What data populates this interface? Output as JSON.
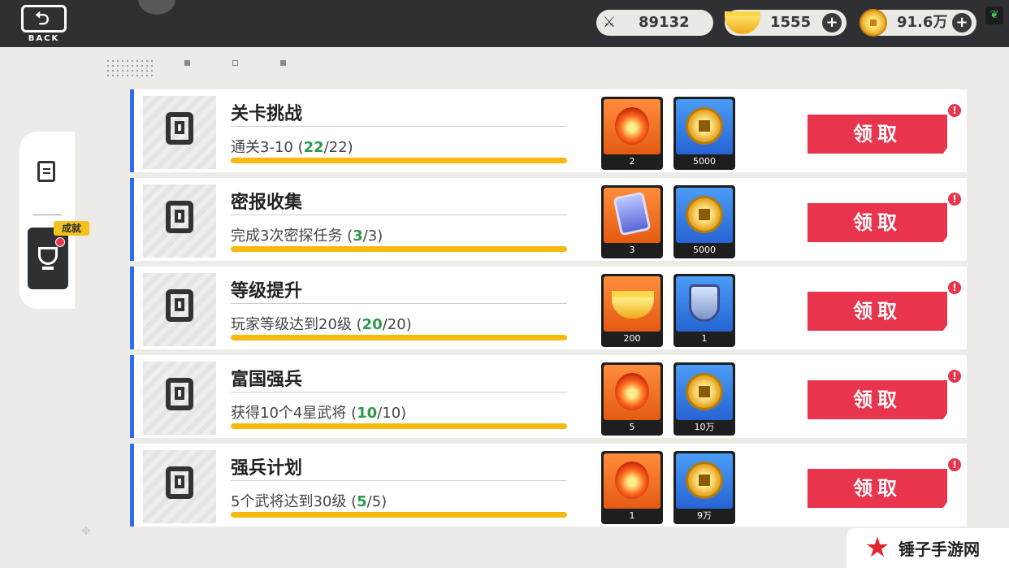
{
  "header": {
    "back_label": "BACK",
    "resources": [
      {
        "icon": "crossed-swords-icon",
        "value": "89132"
      },
      {
        "icon": "gold-ingot-icon",
        "value": "1555"
      },
      {
        "icon": "copper-coin-icon",
        "value": "91.6万"
      }
    ],
    "plus_symbol": "+"
  },
  "sidebar": {
    "active_tab_label": "成就"
  },
  "tasks": [
    {
      "title": "关卡挑战",
      "desc_prefix": "通关3-10 (",
      "current": "22",
      "total": "/22)",
      "progress": 1.0,
      "rewards": [
        {
          "icon": "fire-orb-icon",
          "qty": "2"
        },
        {
          "icon": "copper-coin-icon",
          "qty": "5000"
        }
      ],
      "claim_label": "领取"
    },
    {
      "title": "密报收集",
      "desc_prefix": "完成3次密探任务 (",
      "current": "3",
      "total": "/3)",
      "progress": 1.0,
      "rewards": [
        {
          "icon": "secret-token-icon",
          "qty": "3"
        },
        {
          "icon": "copper-coin-icon",
          "qty": "5000"
        }
      ],
      "claim_label": "领取"
    },
    {
      "title": "等级提升",
      "desc_prefix": "玩家等级达到20级 (",
      "current": "20",
      "total": "/20)",
      "progress": 1.0,
      "rewards": [
        {
          "icon": "gold-ingot-icon",
          "qty": "200"
        },
        {
          "icon": "shield-token-icon",
          "qty": "1"
        }
      ],
      "claim_label": "领取"
    },
    {
      "title": "富国强兵",
      "desc_prefix": "获得10个4星武将 (",
      "current": "10",
      "total": "/10)",
      "progress": 1.0,
      "rewards": [
        {
          "icon": "fire-orb-icon",
          "qty": "5"
        },
        {
          "icon": "copper-coin-icon",
          "qty": "10万"
        }
      ],
      "claim_label": "领取"
    },
    {
      "title": "强兵计划",
      "desc_prefix": "5个武将达到30级 (",
      "current": "5",
      "total": "/5)",
      "progress": 1.0,
      "rewards": [
        {
          "icon": "fire-orb-icon",
          "qty": "1"
        },
        {
          "icon": "copper-coin-icon",
          "qty": "9万"
        }
      ],
      "claim_label": "领取"
    }
  ],
  "alert_symbol": "!",
  "watermark": {
    "text": "锤子手游网"
  },
  "colors": {
    "accent_red": "#e8344d",
    "progress_yellow": "#f6b90e",
    "row_stripe_blue": "#2f6cf0",
    "current_green": "#2a9a4a",
    "topbar_dark": "#2f3033"
  }
}
